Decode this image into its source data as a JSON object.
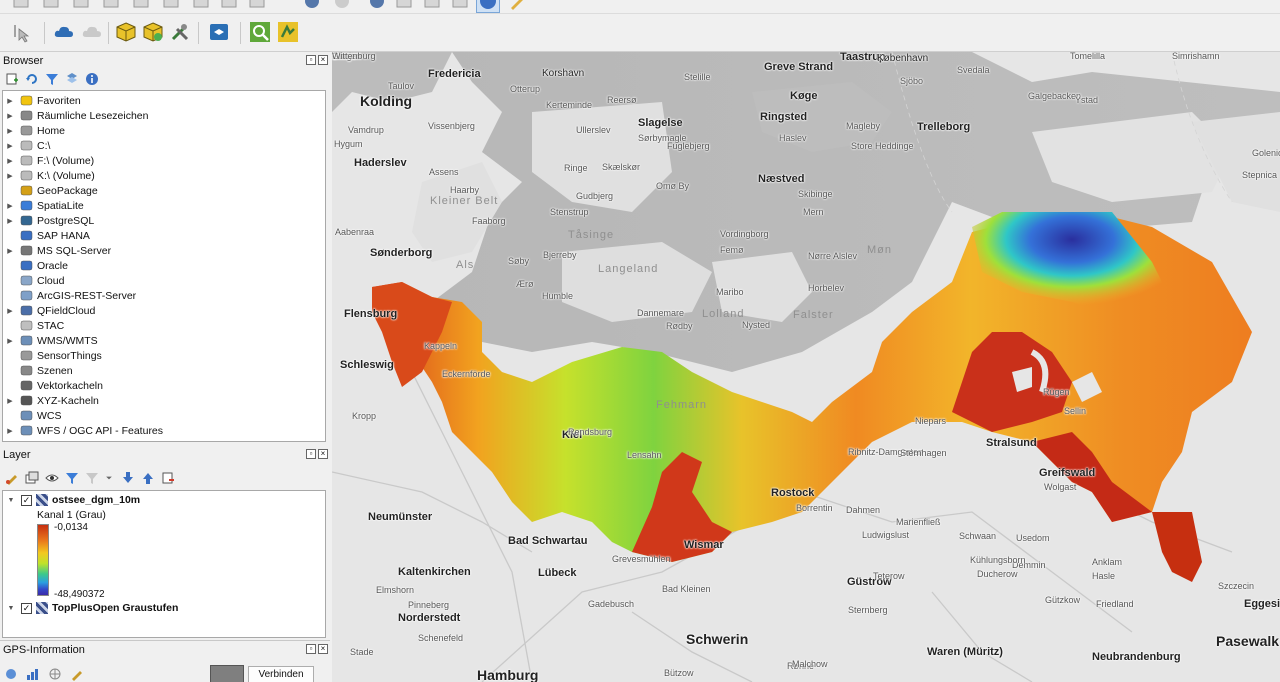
{
  "browser_panel": {
    "title": "Browser",
    "items": [
      {
        "label": "Favoriten",
        "icon": "star-icon",
        "has_arrow": true
      },
      {
        "label": "Räumliche Lesezeichen",
        "icon": "bookmark-icon",
        "has_arrow": true
      },
      {
        "label": "Home",
        "icon": "home-folder-icon",
        "has_arrow": true
      },
      {
        "label": "C:\\",
        "icon": "folder-icon",
        "has_arrow": true
      },
      {
        "label": "F:\\ (Volume)",
        "icon": "folder-icon",
        "has_arrow": true
      },
      {
        "label": "K:\\ (Volume)",
        "icon": "folder-icon",
        "has_arrow": true
      },
      {
        "label": "GeoPackage",
        "icon": "geopackage-icon",
        "has_arrow": false
      },
      {
        "label": "SpatiaLite",
        "icon": "spatialite-icon",
        "has_arrow": true
      },
      {
        "label": "PostgreSQL",
        "icon": "postgresql-icon",
        "has_arrow": true
      },
      {
        "label": "SAP HANA",
        "icon": "sap-hana-icon",
        "has_arrow": false
      },
      {
        "label": "MS SQL-Server",
        "icon": "mssql-icon",
        "has_arrow": true
      },
      {
        "label": "Oracle",
        "icon": "oracle-icon",
        "has_arrow": false
      },
      {
        "label": "Cloud",
        "icon": "cloud-icon",
        "has_arrow": false
      },
      {
        "label": "ArcGIS-REST-Server",
        "icon": "arcgis-icon",
        "has_arrow": false
      },
      {
        "label": "QFieldCloud",
        "icon": "qfieldcloud-icon",
        "has_arrow": true
      },
      {
        "label": "STAC",
        "icon": "stac-icon",
        "has_arrow": false
      },
      {
        "label": "WMS/WMTS",
        "icon": "globe-icon",
        "has_arrow": true
      },
      {
        "label": "SensorThings",
        "icon": "sensor-icon",
        "has_arrow": false
      },
      {
        "label": "Szenen",
        "icon": "scene-icon",
        "has_arrow": false
      },
      {
        "label": "Vektorkacheln",
        "icon": "vector-tiles-icon",
        "has_arrow": false
      },
      {
        "label": "XYZ-Kacheln",
        "icon": "xyz-tiles-icon",
        "has_arrow": true
      },
      {
        "label": "WCS",
        "icon": "globe-icon",
        "has_arrow": false
      },
      {
        "label": "WFS / OGC API - Features",
        "icon": "wfs-icon",
        "has_arrow": true
      }
    ]
  },
  "layers_panel": {
    "title": "Layer",
    "layers": [
      {
        "name": "ostsee_dgm_10m",
        "checked": true,
        "band": "Kanal 1 (Grau)",
        "max_label": "-0,0134",
        "min_label": "-48,490372"
      },
      {
        "name": "TopPlusOpen Graustufen",
        "checked": true
      }
    ]
  },
  "gps_panel": {
    "title": "GPS-Information",
    "connect_label": "Verbinden"
  },
  "colors": {
    "ramp_high": "#c62f10",
    "ramp_low": "#2e3fb3",
    "sea": "#b9b9b9",
    "land": "#e6e6e6"
  },
  "map_labels": [
    "Taastrup",
    "København",
    "Simrishamn",
    "Tomelilla",
    "Fredericia",
    "Korshavn",
    "Greve Strand",
    "Stelille",
    "Kolding",
    "Taulov",
    "Otterup",
    "Kerteminde",
    "Reersø",
    "Køge",
    "Sjöbo",
    "Svedala",
    "Galgebacken",
    "Ystad",
    "Vamdrup",
    "Vissenbjerg",
    "Ullerslev",
    "Slagelse",
    "Sørbymagle",
    "Ringsted",
    "Magleby",
    "Trelleborg",
    "Haderslev",
    "Hygum",
    "Fuglebjerg",
    "Haslev",
    "Store Heddinge",
    "Assens",
    "Ringe",
    "Skælskør",
    "Næstved",
    "Haarby",
    "Omø By",
    "Skibinge",
    "Kleiner Belt",
    "Gudbjerg",
    "Mern",
    "Stenstrup",
    "Tåsinge",
    "Vordingborg",
    "Aabenraa",
    "Faaborg",
    "Femø",
    "Sønderborg",
    "Als",
    "Søby",
    "Bjerreby",
    "Langeland",
    "Nørre Alslev",
    "Møn",
    "Ærø",
    "Humble",
    "Maribo",
    "Horbelev",
    "Flensburg",
    "Lolland",
    "Falster",
    "Dannemare",
    "Nysted",
    "Rødby",
    "Schleswig",
    "Kappeln",
    "Eckernförde",
    "Kropp",
    "Kiel",
    "Lensahn",
    "Fehmarn",
    "Rendsburg",
    "Stralsund",
    "Rügen",
    "Sellin",
    "Niepars",
    "Ribnitz-Damgarten",
    "Sternhagen",
    "Greifswald",
    "Wolgast",
    "Rostock",
    "Neumünster",
    "Bad Schwartau",
    "Lübeck",
    "Grevesmühlen",
    "Wismar",
    "Kaltenkirchen",
    "Elmshorn",
    "Norderstedt",
    "Pinneberg",
    "Hamburg",
    "Stade",
    "Schenefeld",
    "Bad Kleinen",
    "Schwerin",
    "Güstrow",
    "Teterow",
    "Gadebusch",
    "Sternberg",
    "Waren (Müritz)",
    "Neubrandenburg",
    "Demmin",
    "Anklam",
    "Usedom",
    "Gützkow",
    "Friedland",
    "Pasewalk",
    "Eggesin",
    "Szczecin",
    "Goleniów",
    "Stepnica",
    "Hasle",
    "Rønne",
    "Ducherow",
    "Malchow",
    "Borrentin",
    "Dahmen",
    "Marienfließ",
    "Ludwigslust",
    "Schwaan",
    "Kühlungsborn",
    "Bützow",
    "Laage",
    "Dargun",
    "Gnoien",
    "Wittenburg"
  ]
}
